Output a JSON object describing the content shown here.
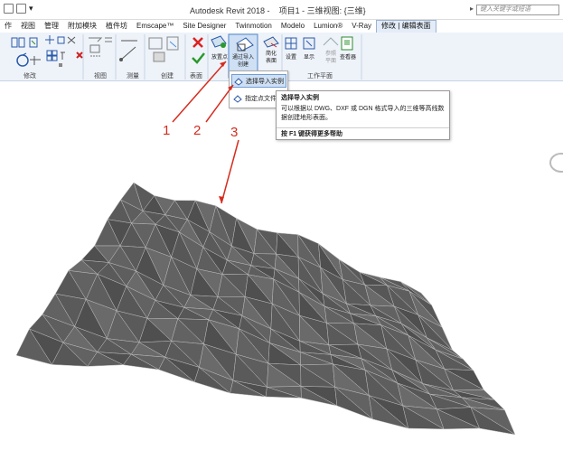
{
  "window": {
    "title": "Autodesk Revit 2018 -",
    "project": "项目1 - 三维视图: {三维}",
    "search_placeholder": "键入关键字或短语"
  },
  "tabs": [
    {
      "label": "作"
    },
    {
      "label": "视图"
    },
    {
      "label": "管理"
    },
    {
      "label": "附加模块"
    },
    {
      "label": "植件坊"
    },
    {
      "label": "Emscape™"
    },
    {
      "label": "Site Designer"
    },
    {
      "label": "Twinmotion"
    },
    {
      "label": "Modelo"
    },
    {
      "label": "Lumion®"
    },
    {
      "label": "V-Ray"
    },
    {
      "label": "修改 | 编辑表面",
      "active": true
    }
  ],
  "ribbon": {
    "panels": [
      "修改",
      "视图",
      "测量",
      "创建",
      "表面",
      "工作平面"
    ],
    "tools": {
      "place_point": "放置点",
      "create_from_import": "通过导入\n创建",
      "simplify": "简化\n表面",
      "set": "设置",
      "show": "显示",
      "ref_plane": "参照\n平面",
      "viewer": "查看器"
    }
  },
  "dropdown": {
    "items": [
      {
        "label": "选择导入实例"
      },
      {
        "label": "指定点文件"
      }
    ]
  },
  "tooltip": {
    "title": "选择导入实例",
    "body": "可以根据以 DWG、DXF 或 DGN 格式导入的三维等高线数据创建地形表面。",
    "help": "按 F1 键获得更多帮助"
  },
  "callouts": [
    "1",
    "2",
    "3"
  ],
  "colors": {
    "ribbon_bg": "#eef3fa",
    "active_tab_bg": "#e3ecf7",
    "highlight": "#cfe0f4",
    "callout_red": "#d62c1e",
    "surface": "#5f5f5f"
  }
}
